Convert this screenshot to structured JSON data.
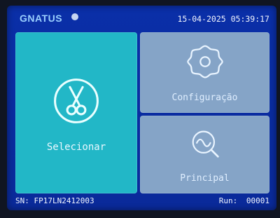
{
  "status": {
    "brand": "GNATUS",
    "datetime": "15-04-2025 05:39:17"
  },
  "tiles": {
    "selecionar": {
      "label": "Selecionar",
      "icon": "scissors-icon",
      "color": "#22b7c7"
    },
    "configuracao": {
      "label": "Configuração",
      "icon": "gear-icon",
      "color": "#85a4c7"
    },
    "principal": {
      "label": "Principal",
      "icon": "magnifier-waveform-icon",
      "color": "#85a4c7"
    }
  },
  "footer": {
    "serial": "SN: FP17LN2412003",
    "run_label": "Run:",
    "run_value": "00001"
  },
  "theme": {
    "background": "#0a2fa8",
    "text": "#f1f6ff"
  }
}
